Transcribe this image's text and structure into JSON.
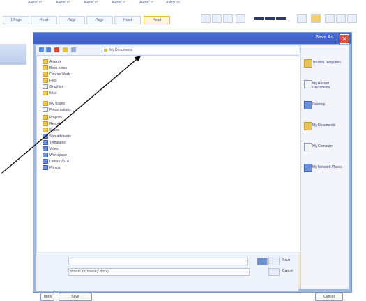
{
  "ribbon": {
    "tabs": [
      "AaBbCcI",
      "AaBbCcI",
      "AaBbCcI",
      "AaBbCcI",
      "AaBbCcI",
      "AaBbCcI"
    ],
    "style_buttons": [
      "1 Page",
      "Head",
      "Page",
      "Page",
      "Head",
      "Head"
    ]
  },
  "dialog": {
    "title": "Save As",
    "path": "My Documents",
    "file_items": [
      "Artwork",
      "Book notes",
      "Course Work",
      "Files",
      "Graphics",
      "Misc",
      "My Scans",
      "Presentations",
      "Projects",
      "Reports",
      "Scans",
      "Spreadsheets",
      "Templates",
      "Video",
      "Workspace",
      "Letters 2014",
      "Photos"
    ],
    "places": [
      "Trusted Templates",
      "My Recent Documents",
      "Desktop",
      "My Documents",
      "My Computer",
      "My Network Places"
    ],
    "file_type_value": "Word Document (*.docx)",
    "side_labels": [
      "Save",
      "Cancel"
    ],
    "footer": {
      "tools": "Tools",
      "save": "Save",
      "cancel": "Cancel"
    }
  },
  "colors": {
    "title_bar": "#3b5ec4",
    "dialog_frame": "#9fb7dd",
    "close": "#d9553c"
  }
}
